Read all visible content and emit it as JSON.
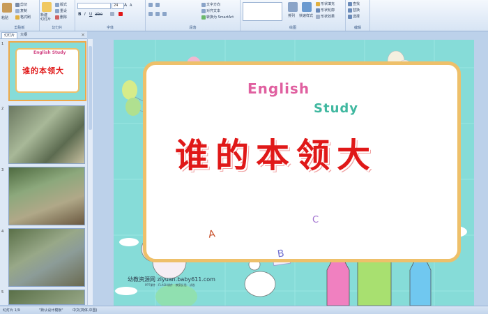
{
  "ribbon": {
    "clipboard": {
      "paste": "粘贴",
      "cut": "剪切",
      "copy": "复制",
      "format_painter": "格式刷",
      "group_label": "剪贴板"
    },
    "slides": {
      "new_slide": "新建\n幻灯片",
      "layout": "版式",
      "reset": "重设",
      "delete": "删除",
      "group_label": "幻灯片"
    },
    "font": {
      "font_name": "",
      "font_size": "24",
      "group_label": "字体"
    },
    "paragraph": {
      "text_direction": "文字方向",
      "align_text": "对齐文本",
      "smartart": "转换为 SmartArt",
      "group_label": "段落"
    },
    "drawing": {
      "arrange": "排列",
      "quick_styles": "快速样式",
      "shape_fill": "形状填充",
      "shape_outline": "形状轮廓",
      "shape_effects": "形状效果",
      "group_label": "绘图"
    },
    "editing": {
      "find": "查找",
      "replace": "替换",
      "select": "选择",
      "group_label": "编辑"
    }
  },
  "panel_tabs": {
    "slides": "幻灯片",
    "outline": "大纲"
  },
  "thumbnails": [
    {
      "number": "1",
      "title": "谁的本领大",
      "english": "English Study",
      "selected": true
    },
    {
      "number": "2"
    },
    {
      "number": "3"
    },
    {
      "number": "4"
    },
    {
      "number": "5"
    }
  ],
  "slide": {
    "title": "谁的本领大",
    "english_line1": "English",
    "english_line2": "Study",
    "website": "幼教资源网 ziyuan.baby611.com",
    "website_sub": "PPT课件 · FLASH课件 · 教案反思 · 试卷",
    "letters": [
      "A",
      "B",
      "C"
    ]
  },
  "status": {
    "slide_count": "幻灯片 1/9",
    "theme": "\"默认设计模板\"",
    "language": "中文(简体,中国)"
  },
  "colors": {
    "accent_red": "#e01818",
    "slide_bg": "#86dcd8",
    "ribbon_bg": "#dde8f5"
  }
}
